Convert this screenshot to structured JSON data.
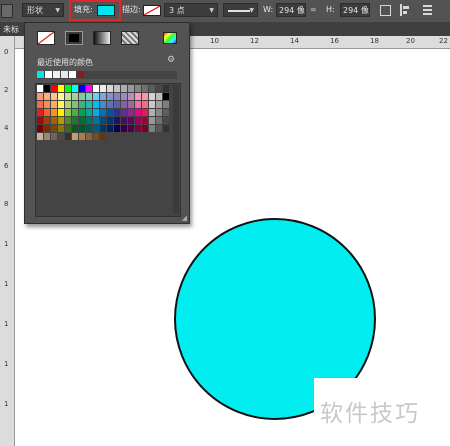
{
  "options_bar": {
    "shape_mode": "形状",
    "fill_label": "填充:",
    "fill_color": "#00e5ee",
    "stroke_label": "描边:",
    "stroke_size": "3 点",
    "width_label": "W:",
    "width_value": "294 像",
    "height_label": "H:",
    "height_value": "294 像"
  },
  "tab": {
    "title": "未标"
  },
  "ruler": {
    "h_ticks": [
      "10",
      "12",
      "14",
      "16",
      "18",
      "20",
      "22"
    ],
    "v_ticks": [
      "0",
      "2",
      "4",
      "6",
      "8",
      "1",
      "1",
      "1",
      "1",
      "1"
    ]
  },
  "picker": {
    "recent_label": "最近使用的颜色",
    "recent_colors": [
      "#00e5ee",
      "#ffffff",
      "#f0f0f0",
      "#e8e8e8",
      "#ffffff",
      "#8b1a1a"
    ],
    "grid_rows": [
      [
        "#ffffff",
        "#000000",
        "#ff0000",
        "#ffff00",
        "#00ff00",
        "#00ffff",
        "#0000ff",
        "#ff00ff",
        "#ffffff",
        "#ebebeb",
        "#d6d6d6",
        "#c2c2c2",
        "#adadad",
        "#999999",
        "#858585",
        "#707070",
        "#5c5c5c",
        "#474747",
        "#333333"
      ],
      [
        "#f7977a",
        "#f9ad81",
        "#fdc68a",
        "#fff79a",
        "#c4df9b",
        "#a3d39c",
        "#82ca9d",
        "#7bcdc8",
        "#6ecff6",
        "#7ea7d8",
        "#8493ca",
        "#8882be",
        "#a187be",
        "#bc8dbf",
        "#f49ac2",
        "#f6989d",
        "#d3d3d3",
        "#bdbdbd",
        "#000000"
      ],
      [
        "#f26c4f",
        "#f68e56",
        "#fbaf5d",
        "#fff568",
        "#acd372",
        "#7cc576",
        "#3bb878",
        "#1abbb4",
        "#00bff3",
        "#448ccb",
        "#5674b9",
        "#605ca8",
        "#855fa8",
        "#a863a8",
        "#f06ea9",
        "#f26d7d",
        "#c8c8c8",
        "#a0a0a0",
        "#7e7e7e"
      ],
      [
        "#ed1c24",
        "#f26522",
        "#f7941d",
        "#fff200",
        "#8dc73f",
        "#39b54a",
        "#00a651",
        "#00a99d",
        "#00aeef",
        "#0072bc",
        "#0054a6",
        "#2e3192",
        "#662d91",
        "#92278f",
        "#ec008c",
        "#ed145b",
        "#b0b0b0",
        "#8a8a8a",
        "#5e5e5e"
      ],
      [
        "#9e0b0f",
        "#a0410d",
        "#a36209",
        "#aba000",
        "#598527",
        "#1a7b30",
        "#007236",
        "#00746b",
        "#0076a3",
        "#004b80",
        "#003471",
        "#1b1464",
        "#440e62",
        "#630460",
        "#9e005d",
        "#9e0039",
        "#989898",
        "#707070",
        "#4a4a4a"
      ],
      [
        "#790000",
        "#7b2e00",
        "#7d4900",
        "#827b00",
        "#406618",
        "#005e20",
        "#005826",
        "#005952",
        "#005b7f",
        "#003663",
        "#002157",
        "#0d004c",
        "#32004b",
        "#4b0049",
        "#7b0046",
        "#7a0026",
        "#808080",
        "#585858",
        "#333333"
      ],
      [
        "#c7b299",
        "#998675",
        "#736357",
        "#534741",
        "#372f2c",
        "#c69c6d",
        "#a67c52",
        "#8c6239",
        "#754c24",
        "#603913"
      ]
    ]
  },
  "shape": {
    "fill": "#00eef0",
    "stroke": "#111111"
  },
  "watermark": {
    "text": "软件技巧"
  }
}
